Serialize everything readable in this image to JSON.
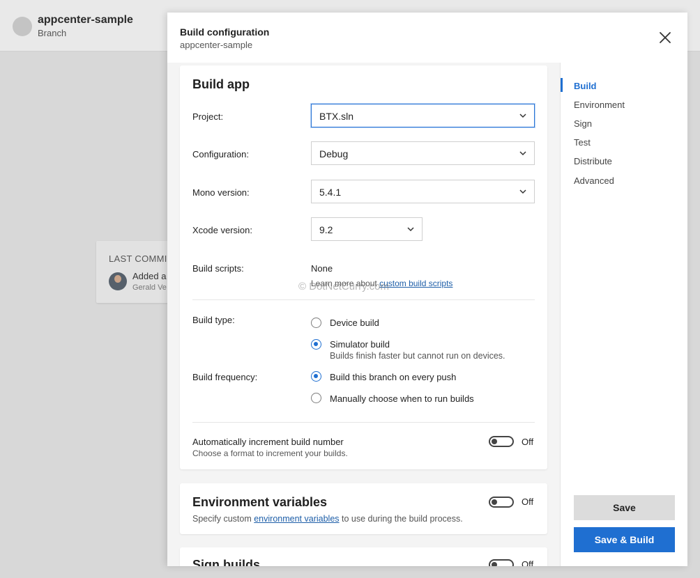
{
  "background": {
    "app_title": "appcenter-sample",
    "app_sub": "Branch",
    "card_title": "LAST COMMIT",
    "card_text": "Added a",
    "card_author": "Gerald Ve"
  },
  "modal": {
    "title": "Build configuration",
    "subtitle": "appcenter-sample"
  },
  "build_app": {
    "title": "Build app",
    "project_label": "Project:",
    "project_value": "BTX.sln",
    "configuration_label": "Configuration:",
    "configuration_value": "Debug",
    "mono_label": "Mono version:",
    "mono_value": "5.4.1",
    "xcode_label": "Xcode version:",
    "xcode_value": "9.2",
    "scripts_label": "Build scripts:",
    "scripts_value": "None",
    "scripts_hint_prefix": "Learn more about ",
    "scripts_hint_link": "custom build scripts",
    "build_type_label": "Build type:",
    "device_build": "Device build",
    "simulator_build": "Simulator build",
    "simulator_hint": "Builds finish faster but cannot run on devices.",
    "frequency_label": "Build frequency:",
    "every_push": "Build this branch on every push",
    "manual": "Manually choose when to run builds",
    "increment_label": "Automatically increment build number",
    "increment_hint": "Choose a format to increment your builds.",
    "increment_toggle": "Off"
  },
  "env": {
    "title": "Environment variables",
    "hint_prefix": "Specify custom ",
    "hint_link": "environment variables",
    "hint_suffix": " to use during the build process.",
    "toggle": "Off"
  },
  "sign": {
    "title": "Sign builds",
    "toggle": "Off"
  },
  "watermark": "© DotNetCurry.com",
  "sidebar": {
    "items": [
      {
        "label": "Build"
      },
      {
        "label": "Environment"
      },
      {
        "label": "Sign"
      },
      {
        "label": "Test"
      },
      {
        "label": "Distribute"
      },
      {
        "label": "Advanced"
      }
    ],
    "save": "Save",
    "save_build": "Save & Build"
  },
  "colors": {
    "accent": "#1f6fd1",
    "link": "#1d5ea8"
  }
}
